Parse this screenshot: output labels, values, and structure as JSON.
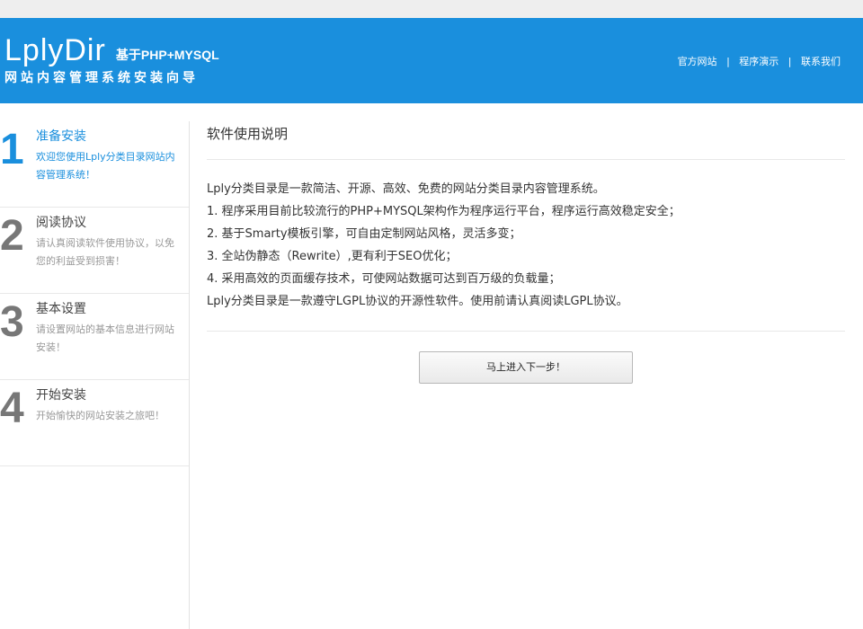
{
  "header": {
    "logo_main": "LplyDir",
    "logo_sub1": "基于PHP+MYSQL",
    "logo_sub2": "网站内容管理系统安装向导",
    "links": [
      "官方网站",
      "程序演示",
      "联系我们"
    ],
    "separator": "|",
    "bg_color": "#1a8fdd"
  },
  "steps": [
    {
      "num": "1",
      "title": "准备安装",
      "desc": "欢迎您使用Lply分类目录网站内容管理系统！",
      "active": true
    },
    {
      "num": "2",
      "title": "阅读协议",
      "desc": "请认真阅读软件使用协议，以免您的利益受到损害！",
      "active": false
    },
    {
      "num": "3",
      "title": "基本设置",
      "desc": "请设置网站的基本信息进行网站安装！",
      "active": false
    },
    {
      "num": "4",
      "title": "开始安装",
      "desc": "开始愉快的网站安装之旅吧！",
      "active": false
    }
  ],
  "main": {
    "title": "软件使用说明",
    "lines": [
      "Lply分类目录是一款简洁、开源、高效、免费的网站分类目录内容管理系统。",
      "1. 程序采用目前比较流行的PHP+MYSQL架构作为程序运行平台，程序运行高效稳定安全；",
      "2. 基于Smarty模板引擎，可自由定制网站风格，灵活多变；",
      "3. 全站伪静态（Rewrite）,更有利于SEO优化；",
      "4. 采用高效的页面缓存技术，可使网站数据可达到百万级的负载量；",
      "Lply分类目录是一款遵守LGPL协议的开源性软件。使用前请认真阅读LGPL协议。"
    ],
    "next_button": "马上进入下一步！"
  }
}
